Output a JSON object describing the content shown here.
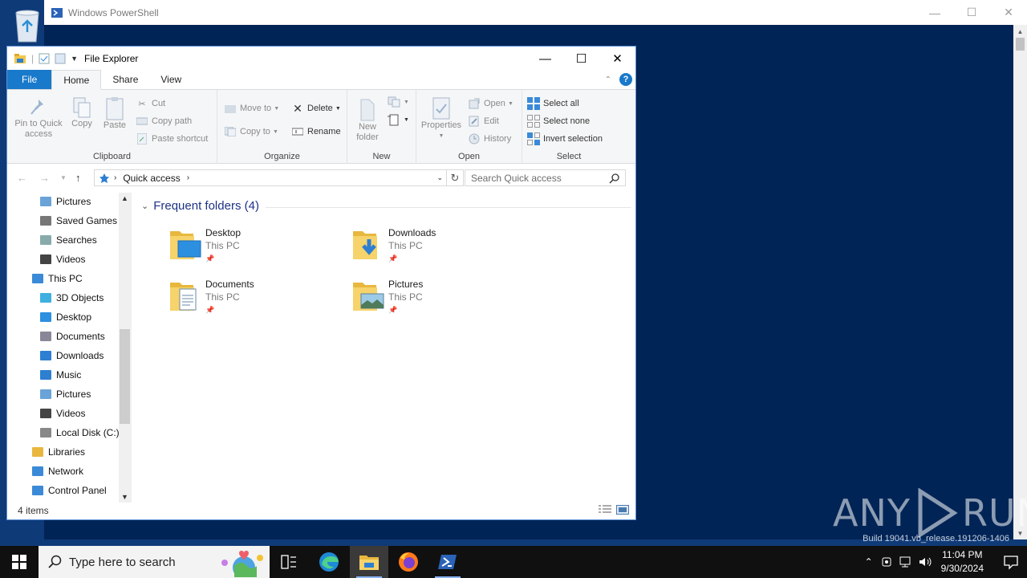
{
  "powershell": {
    "title": "Windows PowerShell",
    "build_text": "Build 19041.vb_release.191206-1406"
  },
  "watermark": {
    "left": "ANY",
    "right": "RUN"
  },
  "explorer": {
    "title": "File Explorer",
    "tabs": [
      "File",
      "Home",
      "Share",
      "View"
    ],
    "active_tab": "Home",
    "ribbon": {
      "clipboard": {
        "label": "Clipboard",
        "pin_label": "Pin to Quick access",
        "copy_label": "Copy",
        "paste_label": "Paste",
        "cut_label": "Cut",
        "copy_path_label": "Copy path",
        "paste_shortcut_label": "Paste shortcut"
      },
      "organize": {
        "label": "Organize",
        "move_to_label": "Move to",
        "copy_to_label": "Copy to",
        "delete_label": "Delete",
        "rename_label": "Rename"
      },
      "new": {
        "label": "New",
        "new_folder_label": "New folder"
      },
      "open": {
        "label": "Open",
        "properties_label": "Properties",
        "open_label": "Open",
        "edit_label": "Edit",
        "history_label": "History"
      },
      "select": {
        "label": "Select",
        "select_all_label": "Select all",
        "select_none_label": "Select none",
        "invert_label": "Invert selection"
      }
    },
    "address": {
      "path": "Quick access",
      "search_placeholder": "Search Quick access"
    },
    "nav_items": [
      {
        "label": "Pictures",
        "icon": "pictures-icon"
      },
      {
        "label": "Saved Games",
        "icon": "saved-games-icon"
      },
      {
        "label": "Searches",
        "icon": "searches-icon"
      },
      {
        "label": "Videos",
        "icon": "videos-icon"
      },
      {
        "label": "This PC",
        "icon": "this-pc-icon"
      },
      {
        "label": "3D Objects",
        "icon": "3d-objects-icon"
      },
      {
        "label": "Desktop",
        "icon": "desktop-icon"
      },
      {
        "label": "Documents",
        "icon": "documents-icon"
      },
      {
        "label": "Downloads",
        "icon": "downloads-icon"
      },
      {
        "label": "Music",
        "icon": "music-icon"
      },
      {
        "label": "Pictures",
        "icon": "pictures-icon"
      },
      {
        "label": "Videos",
        "icon": "videos-icon"
      },
      {
        "label": "Local Disk (C:)",
        "icon": "drive-icon"
      },
      {
        "label": "Libraries",
        "icon": "libraries-icon"
      },
      {
        "label": "Network",
        "icon": "network-icon"
      },
      {
        "label": "Control Panel",
        "icon": "control-panel-icon"
      }
    ],
    "section_title": "Frequent folders (4)",
    "folders": [
      {
        "name": "Desktop",
        "location": "This PC"
      },
      {
        "name": "Downloads",
        "location": "This PC"
      },
      {
        "name": "Documents",
        "location": "This PC"
      },
      {
        "name": "Pictures",
        "location": "This PC"
      }
    ],
    "status": "4 items"
  },
  "taskbar": {
    "search_placeholder": "Type here to search",
    "time": "11:04 PM",
    "date": "9/30/2024"
  },
  "colors": {
    "accent": "#1979ca",
    "powershell_bg": "#012456",
    "section_title": "#1e3287"
  }
}
